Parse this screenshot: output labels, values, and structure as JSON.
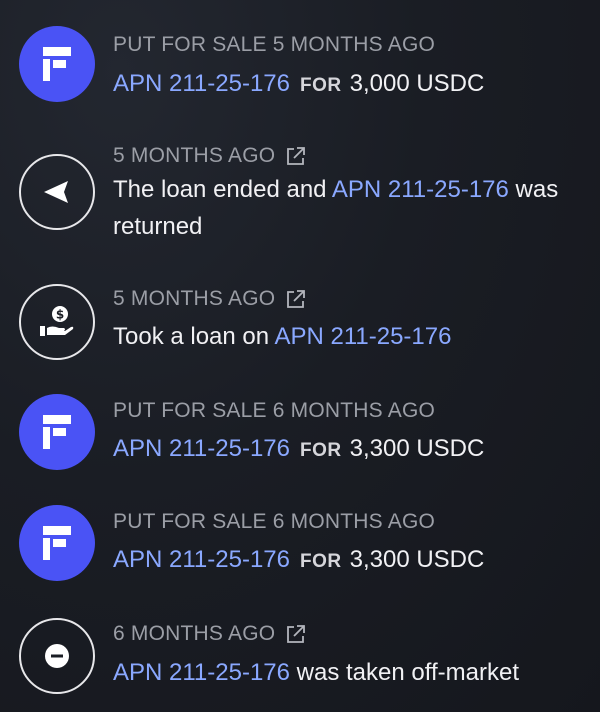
{
  "feed": {
    "items": [
      {
        "type": "sale",
        "icon": "brand-f-logo-icon",
        "meta": "PUT FOR SALE 5 MONTHS AGO",
        "apn": "APN 211-25-176",
        "for_word": "FOR",
        "price": "3,000 USDC"
      },
      {
        "type": "loan-ended",
        "icon": "send-arrow-icon",
        "meta": "5 MONTHS AGO",
        "text_before": "The loan ended and ",
        "apn": "APN 211-25-176",
        "text_after": " was returned"
      },
      {
        "type": "loan",
        "icon": "hand-dollar-icon",
        "meta": "5 MONTHS AGO",
        "text_before": "Took a loan on ",
        "apn": "APN 211-25-176"
      },
      {
        "type": "sale",
        "icon": "brand-f-logo-icon",
        "meta": "PUT FOR SALE 6 MONTHS AGO",
        "apn": "APN 211-25-176",
        "for_word": "FOR",
        "price": "3,300 USDC"
      },
      {
        "type": "sale",
        "icon": "brand-f-logo-icon",
        "meta": "PUT FOR SALE 6 MONTHS AGO",
        "apn": "APN 211-25-176",
        "for_word": "FOR",
        "price": "3,300 USDC"
      },
      {
        "type": "off-market",
        "icon": "minus-circle-icon",
        "meta": "6 MONTHS AGO",
        "apn": "APN 211-25-176",
        "text_after": " was taken off-market"
      }
    ]
  },
  "colors": {
    "brand": "#4a53f5",
    "link": "#8aa8ff",
    "muted": "#9b9ea6",
    "text": "#f1f1f4",
    "background": "#1a1d24"
  }
}
